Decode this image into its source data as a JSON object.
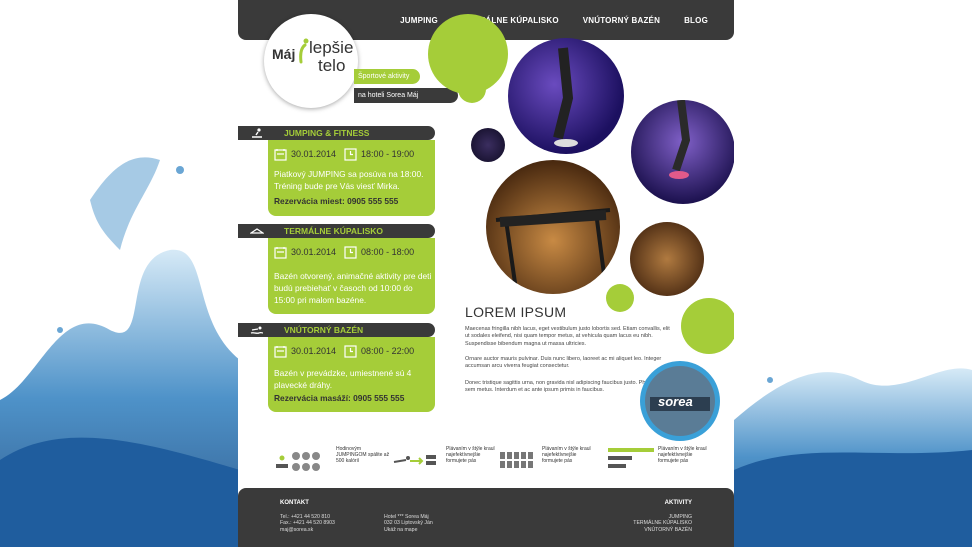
{
  "nav": {
    "items": [
      "JUMPING",
      "TERMÁLNE KÚPALISKO",
      "VNÚTORNÝ BAZÉN",
      "BLOG"
    ]
  },
  "logo": {
    "maj": "Máj",
    "lepsie": "lepšie",
    "telo": "telo"
  },
  "tags": {
    "sport": "Športové aktivity",
    "hotel": "na hoteli Sorea Máj"
  },
  "sections": [
    {
      "title": "JUMPING & FITNESS",
      "date": "30.01.2014",
      "time": "18:00 - 19:00",
      "desc": "Piatkový JUMPING sa posúva na 18:00. Tréning bude pre Vás viesť Mirka.",
      "reserve": "Rezervácia miest: 0905 555 555"
    },
    {
      "title": "TERMÁLNE KÚPALISKO",
      "date": "30.01.2014",
      "time": "08:00 - 18:00",
      "desc": "Bazén otvorený, animačné aktivity pre deti budú prebiehať v časoch od 10:00 do 15:00 pri malom bazéne."
    },
    {
      "title": "VNÚTORNÝ BAZÉN",
      "date": "30.01.2014",
      "time": "08:00 - 22:00",
      "desc": "Bazén v prevádzke, umiestnené sú 4 plavecké dráhy.",
      "reserve": "Rezervácia masáží: 0905 555 555"
    }
  ],
  "article": {
    "title": "LOREM IPSUM",
    "p1": "Maecenas fringilla nibh lacus, eget vestibulum justo lobortis sed. Etiam convallis, elit ut sodales eleifend, nisi quam tempor metus, at vehicula quam lacus eu nibh. Suspendisse bibendum magna ut massa ultricies.",
    "p2": "Ornare auctor mauris pulvinar. Duis nunc libero, laoreet ac mi aliquet leo. Integer accumsan arcu viverra feugiat consectetur.",
    "p3": "Donec tristique sagittis urna, non gravida nisl adipiscing faucibus justo. Phasellus non sem metus. Interdum et ac ante ipsum primis in faucibus."
  },
  "badge": {
    "text": "sorea"
  },
  "features": [
    {
      "text": "Hodinovým JUMPINGOM spálite až 500 kalórií"
    },
    {
      "text": "Plávaním v štýle kraul najefektívnejšie formujete pás"
    },
    {
      "text": "Plávaním v štýle kraul najefektívnejšie formujete pás"
    },
    {
      "text": "Plávaním v štýle kraul najefektívnejšie formujete pás"
    }
  ],
  "footer": {
    "kontakt_head": "KONTAKT",
    "tel": "Tel.: +421 44 520 810",
    "fax": "Fax.: +421 44 520 8903",
    "email": "maj@sorea.sk",
    "hotel": "Hotel *** Sorea Máj",
    "address": "032 03 Liptovský Ján",
    "map": "Ukáž na mape",
    "aktivity_head": "AKTIVITY",
    "links": [
      "JUMPING",
      "TERMÁLNE KÚPALISKO",
      "VNÚTORNÝ BAZÉN"
    ]
  },
  "colors": {
    "accent": "#a5cd39",
    "dark": "#3a3a3a",
    "badge": "#3aa0d8"
  },
  "icons": [
    "trampoline-icon",
    "pool-icon",
    "swimmer-icon",
    "calendar-icon",
    "clock-icon"
  ]
}
